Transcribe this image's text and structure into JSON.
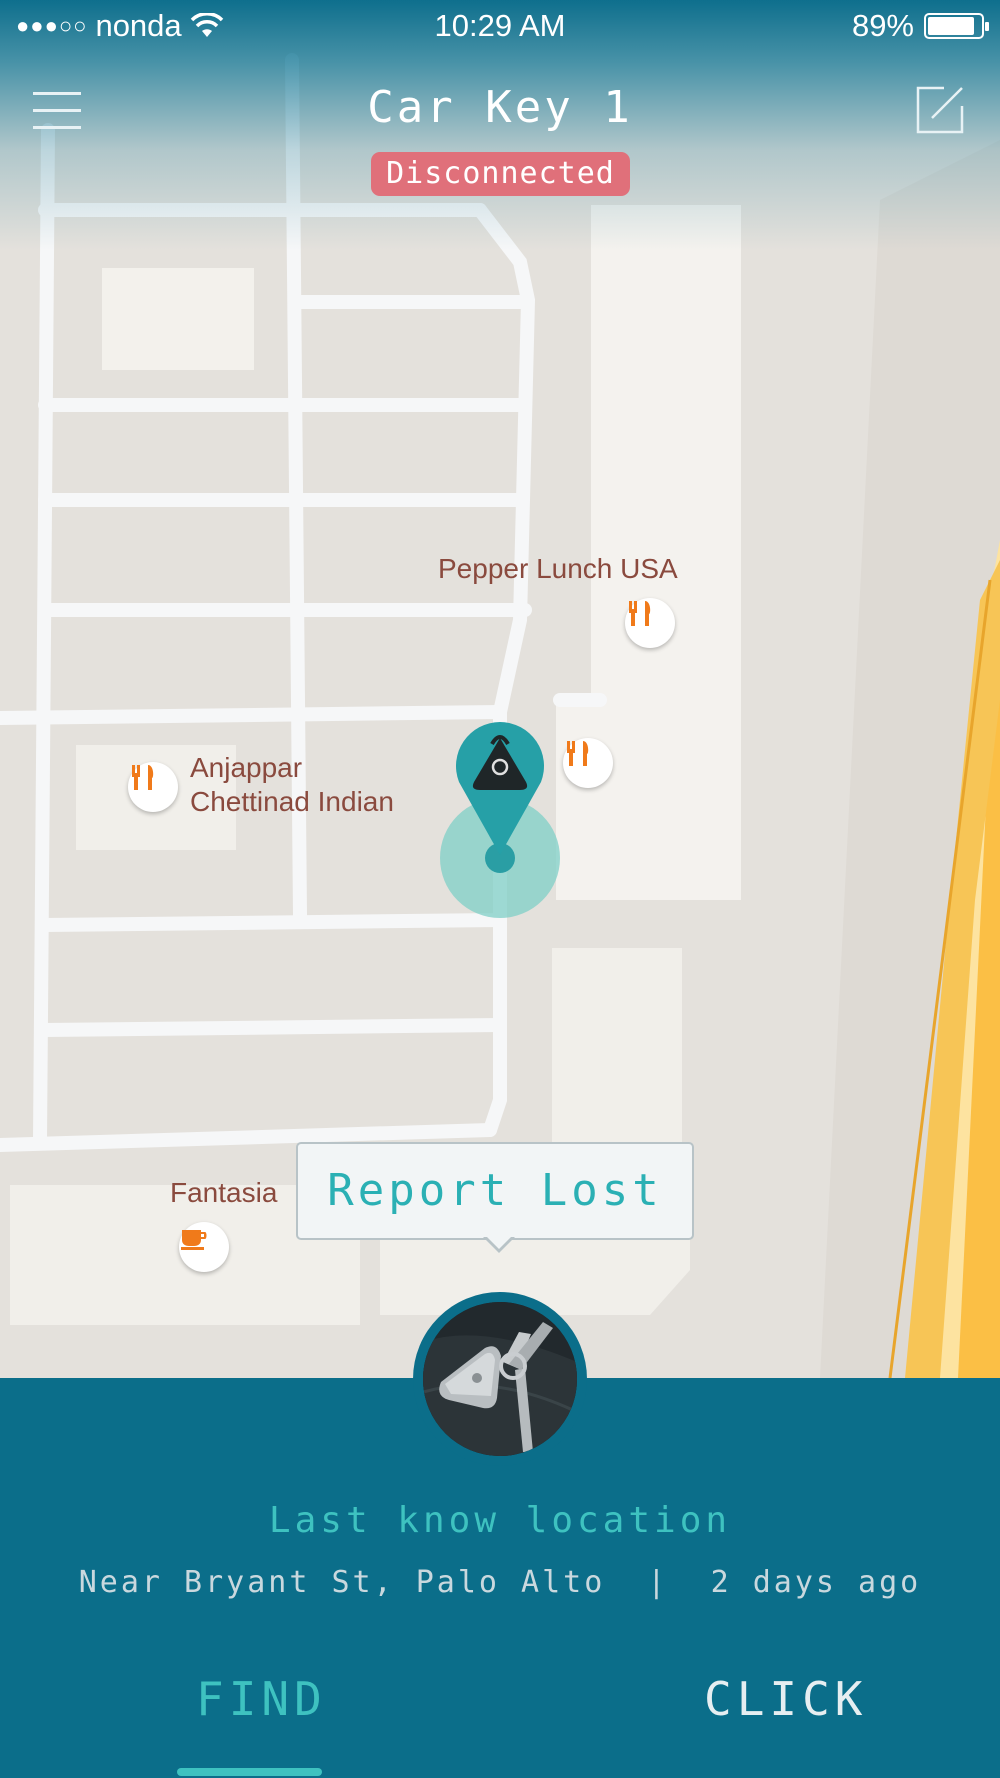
{
  "status_bar": {
    "carrier": "nonda",
    "signal_dots": "●●●○○",
    "time": "10:29 AM",
    "battery_percent": "89%",
    "battery_level": 0.89
  },
  "header": {
    "title": "Car Key 1",
    "connection_status": "Disconnected",
    "menu_icon": "hamburger-menu-icon",
    "edit_icon": "edit-square-icon"
  },
  "map": {
    "places": [
      {
        "name": "Pepper Lunch USA",
        "icon": "restaurant-icon"
      },
      {
        "name": "Anjappar\nChettinad Indian",
        "icon": "restaurant-icon"
      },
      {
        "name": "Fantasia",
        "icon": "cafe-icon"
      }
    ],
    "unlabeled_poi_icon": "restaurant-icon",
    "marker_icon": "tracker-location-pin-icon"
  },
  "report_lost": {
    "label": "Report Lost"
  },
  "bottom_panel": {
    "heading": "Last know location",
    "location": "Near Bryant St, Palo Alto",
    "separator": "|",
    "time_ago": "2 days ago",
    "tabs": [
      {
        "label": "FIND",
        "active": true
      },
      {
        "label": "CLICK",
        "active": false
      }
    ]
  },
  "colors": {
    "accent": "#3ec2c0",
    "panel": "#0b6e8a",
    "disconnected": "#e0707a",
    "highway": "#fbbf45"
  }
}
